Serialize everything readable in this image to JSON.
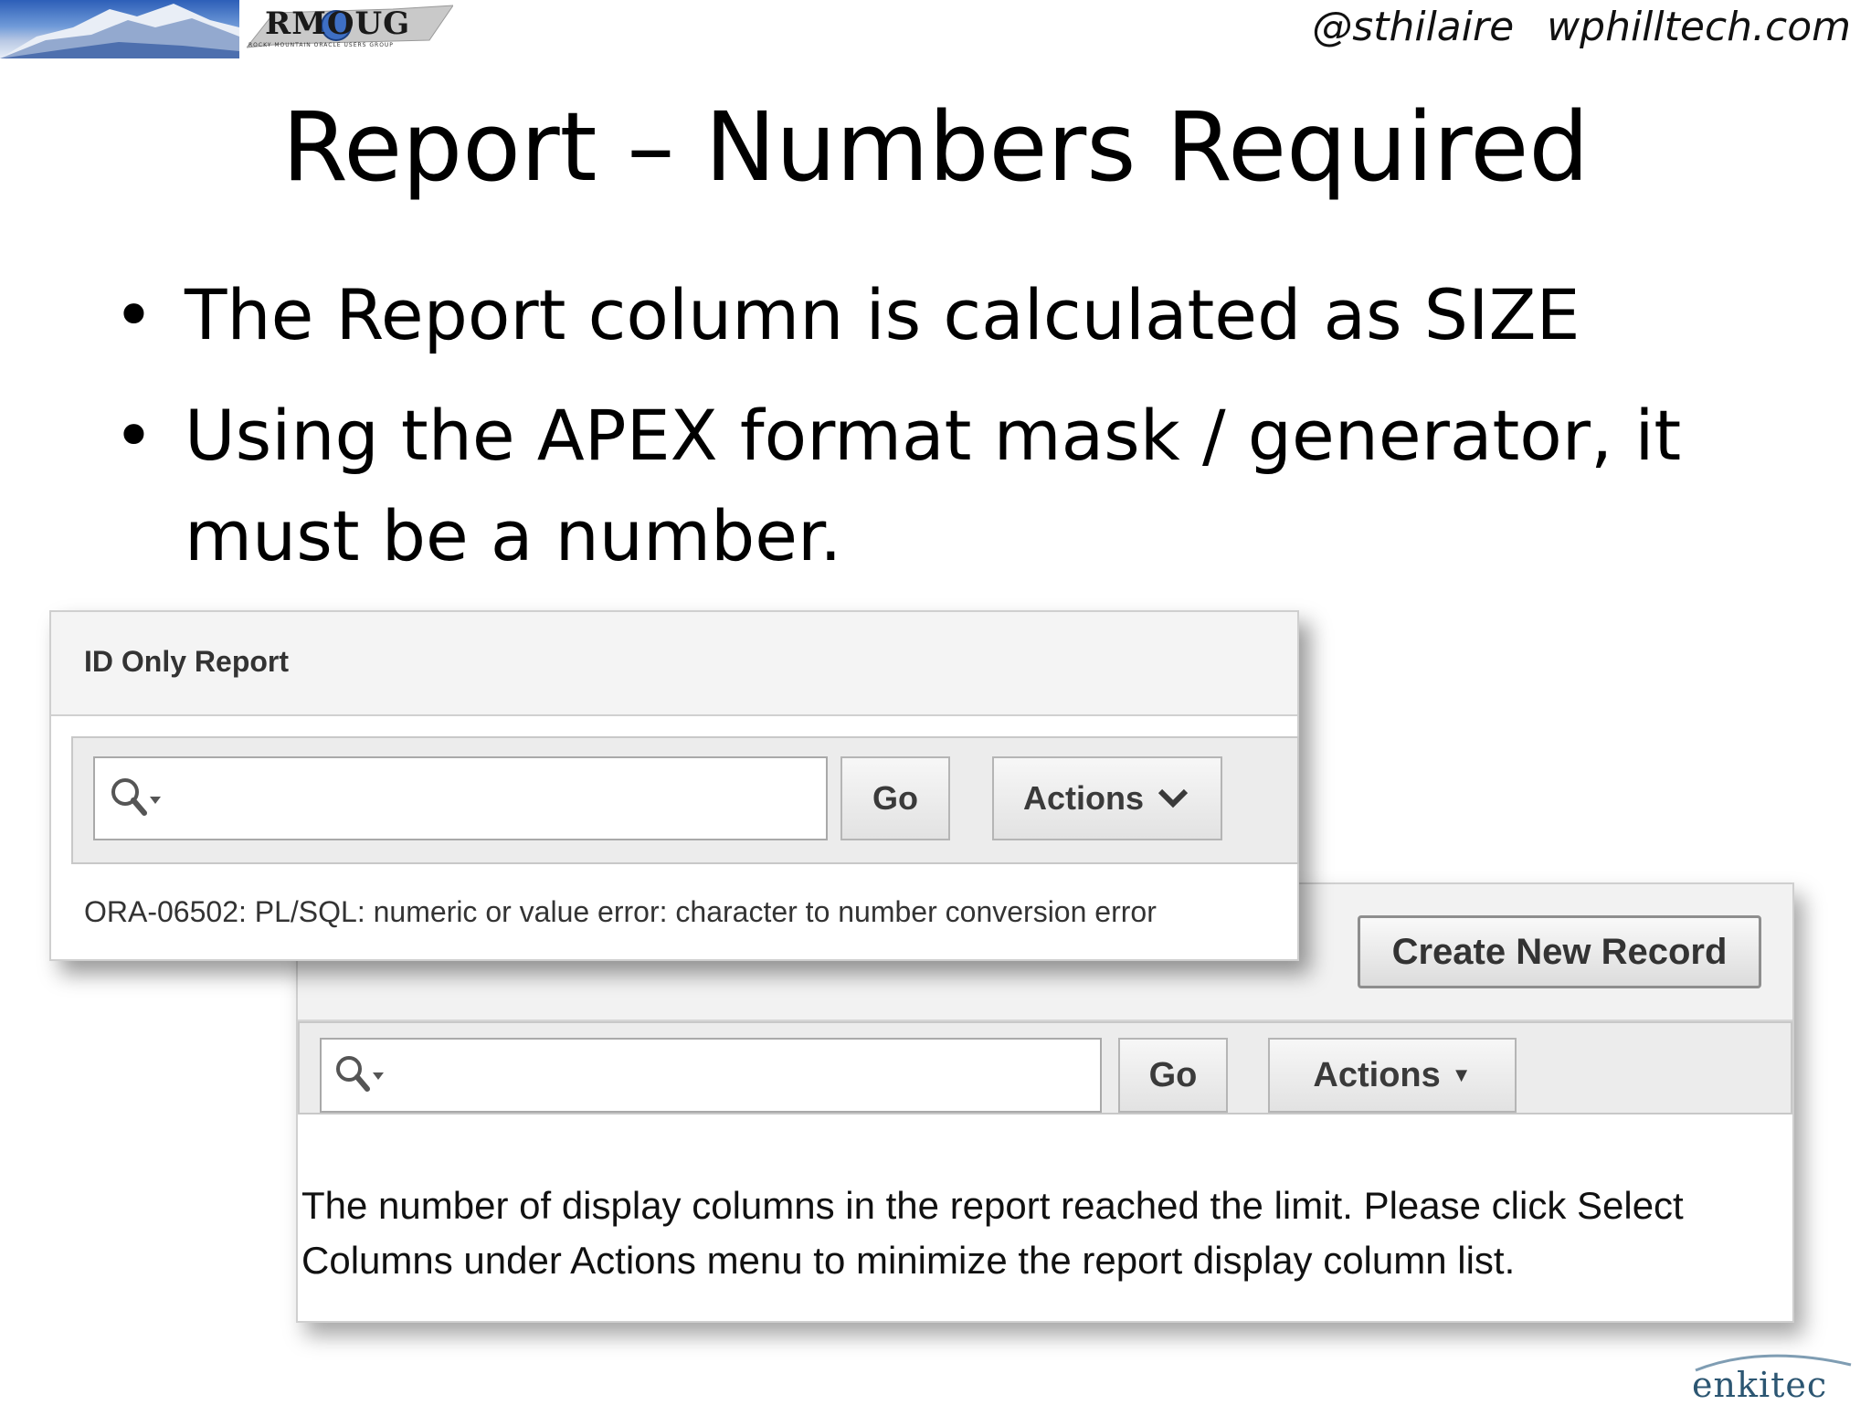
{
  "header": {
    "logo_text": "RMOUG",
    "logo_subtext": "ROCKY MOUNTAIN ORACLE USERS GROUP",
    "twitter": "@sthilaire",
    "website": "wphilltech.com"
  },
  "slide": {
    "title": "Report – Numbers Required",
    "bullets": [
      "The Report column is calculated as SIZE",
      "Using the APEX format mask / generator, it must be a number."
    ]
  },
  "front_panel": {
    "region_title": "ID Only Report",
    "search_placeholder": "",
    "go_label": "Go",
    "actions_label": "Actions",
    "error_message": "ORA-06502: PL/SQL: numeric or value error: character to number conversion error"
  },
  "back_panel": {
    "create_label": "Create New Record",
    "search_placeholder": "",
    "go_label": "Go",
    "actions_label": "Actions",
    "limit_message": "The number of display columns in the report reached the limit. Please click Select Columns under Actions menu to minimize the report display column list."
  },
  "footer": {
    "brand": "enkitec"
  },
  "icons": {
    "search": "search-icon",
    "chevron": "chevron-down-icon",
    "caret": "caret-down-icon"
  }
}
